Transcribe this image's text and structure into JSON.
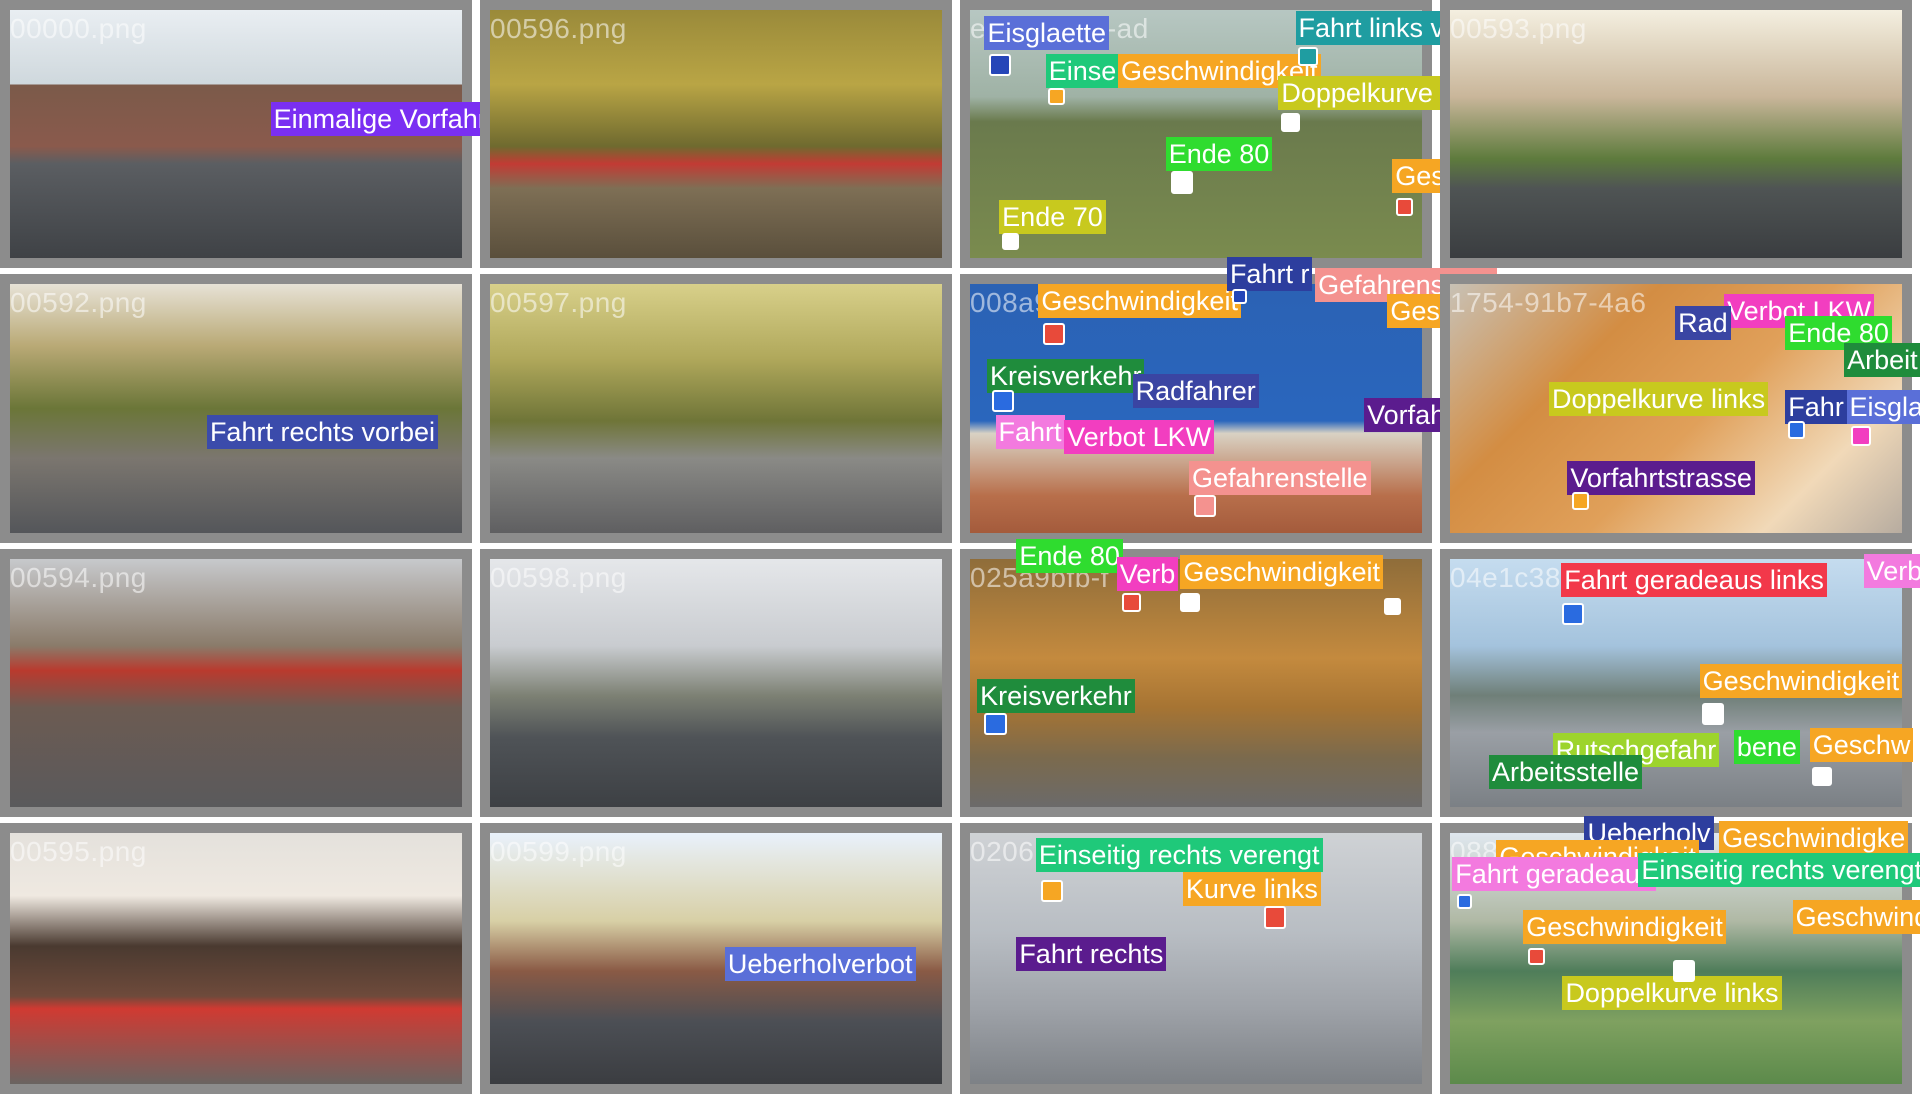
{
  "tiles": [
    {
      "filename": "00000.png",
      "labels": [
        {
          "text": "Einmalige Vorfahrt",
          "color": "#7a2ff2"
        }
      ]
    },
    {
      "filename": "00596.png",
      "labels": []
    },
    {
      "filename": "e4cd-464b-ad",
      "labels": [
        {
          "text": "Eisglaette",
          "color": "#5a6fd8"
        },
        {
          "text": "Einse",
          "color": "#1fc97a"
        },
        {
          "text": "Geschwindigkeit",
          "color": "#f6a623"
        },
        {
          "text": "Fahrt links vorbei",
          "color": "#1f9da1"
        },
        {
          "text": "Doppelkurve links",
          "color": "#c8c91e"
        },
        {
          "text": "Ende 80",
          "color": "#2fdc2f"
        },
        {
          "text": "Geschwindigkeit",
          "color": "#f6a623"
        },
        {
          "text": "Ende 70",
          "color": "#c8c91e"
        }
      ]
    },
    {
      "filename": "00593.png",
      "labels": []
    },
    {
      "filename": "00592.png",
      "labels": [
        {
          "text": "Fahrt rechts vorbei",
          "color": "#3b4bab"
        }
      ]
    },
    {
      "filename": "00597.png",
      "labels": []
    },
    {
      "filename": "008a9",
      "labels": [
        {
          "text": "Geschwindigkeit",
          "color": "#f6a623"
        },
        {
          "text": "Fahrt r",
          "color": "#2d3e9e"
        },
        {
          "text": "Gefahrenstelle",
          "color": "#f4928f"
        },
        {
          "text": "Geschwindigkeit",
          "color": "#f6a623"
        },
        {
          "text": "Kreisverkehr",
          "color": "#1f8c3c"
        },
        {
          "text": "Radfahrer",
          "color": "#3a45a3"
        },
        {
          "text": "Fahrt",
          "color": "#f37adf"
        },
        {
          "text": "Verbot LKW",
          "color": "#f23ec0"
        },
        {
          "text": "Vorfahrtstrasse",
          "color": "#5b1c8e"
        },
        {
          "text": "Gefahrenstelle",
          "color": "#f4928f"
        }
      ]
    },
    {
      "filename": "1754-91b7-4a6",
      "labels": [
        {
          "text": "Verbot LKW",
          "color": "#f23ec0"
        },
        {
          "text": "Rad",
          "color": "#3a45a3"
        },
        {
          "text": "Ende 80",
          "color": "#2fdc2f"
        },
        {
          "text": "Arbeit",
          "color": "#1f8c3c"
        },
        {
          "text": "Doppelkurve links",
          "color": "#c8c91e"
        },
        {
          "text": "Fahr",
          "color": "#2d3e9e"
        },
        {
          "text": "Eisgla",
          "color": "#5a6fd8"
        },
        {
          "text": "Vorfahrtstrasse",
          "color": "#5b1c8e"
        }
      ]
    },
    {
      "filename": "00594.png",
      "labels": []
    },
    {
      "filename": "00598.png",
      "labels": []
    },
    {
      "filename": "025a9bfb-f",
      "labels": [
        {
          "text": "Ende 80",
          "color": "#2fdc2f"
        },
        {
          "text": "Verb",
          "color": "#f23ec0"
        },
        {
          "text": "Geschwindigkeit",
          "color": "#f6a623"
        },
        {
          "text": "Kreisverkehr",
          "color": "#1f8c3c"
        }
      ]
    },
    {
      "filename": "04e1c38",
      "labels": [
        {
          "text": "Fahrt geradeaus links",
          "color": "#f2384a"
        },
        {
          "text": "Verb",
          "color": "#f37adf"
        },
        {
          "text": "Geschwindigkeit",
          "color": "#f6a623"
        },
        {
          "text": "Rutschgefahr",
          "color": "#9dd42c"
        },
        {
          "text": "bene",
          "color": "#2fdc2f"
        },
        {
          "text": "Geschw",
          "color": "#f6a623"
        },
        {
          "text": "Arbeitsstelle",
          "color": "#1f8c3c"
        }
      ]
    },
    {
      "filename": "00595.png",
      "labels": []
    },
    {
      "filename": "00599.png",
      "labels": [
        {
          "text": "Ueberholverbot",
          "color": "#5a6fd8"
        }
      ]
    },
    {
      "filename": "0206",
      "labels": [
        {
          "text": "Einseitig rechts verengt",
          "color": "#1fc97a"
        },
        {
          "text": "Kurve links",
          "color": "#f6a623"
        },
        {
          "text": "Fahrt rechts",
          "color": "#5b1c8e"
        }
      ]
    },
    {
      "filename": "088",
      "labels": [
        {
          "text": "Ueberholv",
          "color": "#2d3e9e"
        },
        {
          "text": "Geschwindigkeit",
          "color": "#f6a623"
        },
        {
          "text": "Geschwindigke",
          "color": "#f6a623"
        },
        {
          "text": "Fahrt geradeaus",
          "color": "#f37adf"
        },
        {
          "text": "Einseitig rechts verengt",
          "color": "#1fc97a"
        },
        {
          "text": "Geschwindigkeit",
          "color": "#f6a623"
        },
        {
          "text": "Geschwindigkeit",
          "color": "#f6a623"
        },
        {
          "text": "Doppelkurve links",
          "color": "#c8c91e"
        }
      ]
    }
  ]
}
